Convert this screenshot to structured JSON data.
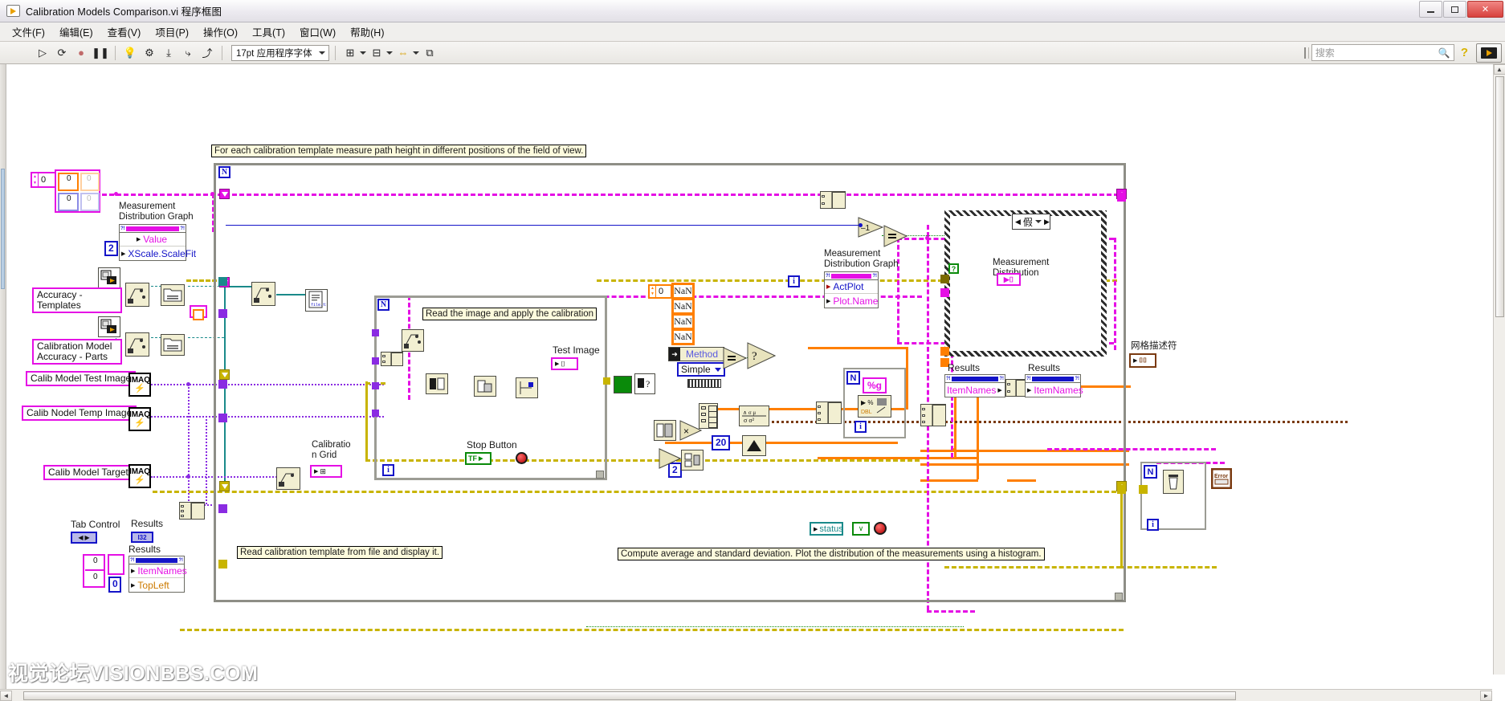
{
  "window": {
    "title": "Calibration Models Comparison.vi 程序框图",
    "icon": "labview-vi-icon",
    "minimize_label": "",
    "maximize_label": "",
    "close_label": "✕"
  },
  "menu": {
    "items": [
      {
        "label": "文件(F)",
        "name": "menu-file"
      },
      {
        "label": "编辑(E)",
        "name": "menu-edit"
      },
      {
        "label": "查看(V)",
        "name": "menu-view"
      },
      {
        "label": "项目(P)",
        "name": "menu-project"
      },
      {
        "label": "操作(O)",
        "name": "menu-operate"
      },
      {
        "label": "工具(T)",
        "name": "menu-tools"
      },
      {
        "label": "窗口(W)",
        "name": "menu-window"
      },
      {
        "label": "帮助(H)",
        "name": "menu-help"
      }
    ]
  },
  "toolbar": {
    "run": "▷",
    "run_continuously": "⟳",
    "abort": "●",
    "pause": "❚❚",
    "highlight_execution": "💡",
    "retain_wire_values": "⚙",
    "step_into": "⤓",
    "step_over": "⤷",
    "step_out": "⤴",
    "font_combo_value": "17pt 应用程序字体",
    "align_objects": "⊞",
    "distribute_objects": "⊟",
    "resize_objects": "⇔",
    "reorder": "⧉",
    "search_placeholder": "搜索",
    "search_icon": "🔍",
    "help_icon": "?"
  },
  "diagram": {
    "comments": [
      {
        "name": "comment-outer-loop",
        "text": "For each calibration template measure path height in different positions of the field of view."
      },
      {
        "name": "comment-read-image",
        "text": "Read the image and apply the calibration"
      },
      {
        "name": "comment-read-template",
        "text": "Read calibration template from file and display it."
      },
      {
        "name": "comment-compute-stats",
        "text": "Compute average and standard deviation. Plot the distribution of the measurements using a histogram."
      }
    ],
    "control_labels": [
      {
        "name": "label-accuracy-templates",
        "text": "Accuracy -\nTemplates"
      },
      {
        "name": "label-calibration-model-accuracy-parts",
        "text": "Calibration Model\nAccuracy - Parts"
      },
      {
        "name": "label-calib-model-test-image",
        "text": "Calib Model Test Image"
      },
      {
        "name": "label-calib-nodel-temp-image",
        "text": "Calib Nodel Temp Image"
      },
      {
        "name": "label-calib-model-target",
        "text": "Calib Model Target"
      }
    ],
    "text_labels": [
      {
        "name": "label-measurement-distribution-graph-left",
        "text": "Measurement\nDistribution Graph"
      },
      {
        "name": "label-measurement-distribution-graph-right",
        "text": "Measurement\nDistribution Graph"
      },
      {
        "name": "label-measurement-distribution-case",
        "text": "Measurement\nDistribution"
      },
      {
        "name": "label-test-image",
        "text": "Test Image"
      },
      {
        "name": "label-calibration-grid",
        "text": "Calibratio\nn Grid"
      },
      {
        "name": "label-stop-button",
        "text": "Stop Button"
      },
      {
        "name": "label-tab-control",
        "text": "Tab Control"
      },
      {
        "name": "label-results-i32",
        "text": "Results"
      },
      {
        "name": "label-results-itemnames-left",
        "text": "Results"
      },
      {
        "name": "label-results-itemnames-mid",
        "text": "Results"
      },
      {
        "name": "label-results-itemnames-right",
        "text": "Results"
      },
      {
        "name": "label-grid-descriptor",
        "text": "网格描述符"
      },
      {
        "name": "label-status",
        "text": "status"
      }
    ],
    "property_nodes": [
      {
        "name": "propnode-measurement-distribution-graph-left",
        "rows": [
          "Value",
          "XScale.ScaleFit"
        ]
      },
      {
        "name": "propnode-measurement-distribution-graph-right",
        "rows": [
          "ActPlot",
          "Plot.Name"
        ]
      },
      {
        "name": "propnode-results-left",
        "rows": [
          "ItemNames",
          "TopLeft"
        ]
      },
      {
        "name": "propnode-results-mid",
        "rows": [
          "ItemNames"
        ]
      },
      {
        "name": "propnode-results-right",
        "rows": [
          "ItemNames"
        ]
      }
    ],
    "constants": [
      {
        "name": "const-zero-top-left",
        "value": "0"
      },
      {
        "name": "const-zero-cluster-a",
        "value": "0"
      },
      {
        "name": "const-zero-cluster-b",
        "value": "0"
      },
      {
        "name": "const-zero-cluster-c",
        "value": "0"
      },
      {
        "name": "const-zero-cluster-d",
        "value": "0"
      },
      {
        "name": "const-two-xscale",
        "value": "2"
      },
      {
        "name": "const-zero-nan-array",
        "value": "0"
      },
      {
        "name": "const-nan-1",
        "value": "NaN"
      },
      {
        "name": "const-nan-2",
        "value": "NaN"
      },
      {
        "name": "const-nan-3",
        "value": "NaN"
      },
      {
        "name": "const-nan-4",
        "value": "NaN"
      },
      {
        "name": "const-twenty",
        "value": "20"
      },
      {
        "name": "const-two-lower",
        "value": "2"
      },
      {
        "name": "const-minus-one",
        "value": "-1"
      },
      {
        "name": "const-format-g",
        "value": "%g"
      },
      {
        "name": "const-zero-tab-a",
        "value": "0"
      },
      {
        "name": "const-zero-tab-b",
        "value": "0"
      },
      {
        "name": "const-zero-tab-c",
        "value": "0"
      }
    ],
    "enums": [
      {
        "name": "enum-method-label",
        "text": "Method"
      },
      {
        "name": "enum-method-value",
        "text": "Simple"
      },
      {
        "name": "case-selector-false",
        "text": "假"
      }
    ],
    "terminals": [
      {
        "name": "terminal-imaq-test-image",
        "text": "IMAQ"
      },
      {
        "name": "terminal-imaq-temp-image",
        "text": "IMAQ"
      },
      {
        "name": "terminal-imaq-target",
        "text": "IMAQ"
      },
      {
        "name": "terminal-results-i32",
        "text": "I32"
      },
      {
        "name": "terminal-stop-button",
        "text": "TF"
      },
      {
        "name": "terminal-file-path",
        "text": "file.txt"
      },
      {
        "name": "terminal-error-out",
        "text": "error"
      }
    ],
    "colors": {
      "wire_magenta": "#e510e5",
      "wire_orange": "#ff7f00",
      "wire_blue": "#1414c8",
      "wire_yellow": "#c8b400",
      "wire_purple": "#8a2be2",
      "wire_teal": "#1a8a8a",
      "wire_brown": "#7a3a10",
      "wire_green": "#0a8a0a",
      "node_beige": "#f2efd2",
      "comment_bg": "#fdfbdd"
    }
  },
  "watermark": {
    "text": "视觉论坛VISIONBBS.COM"
  },
  "scrollbars": {
    "h_left_arrow": "◄",
    "h_right_arrow": "►",
    "v_up_arrow": "▲",
    "v_down_arrow": "▼"
  }
}
